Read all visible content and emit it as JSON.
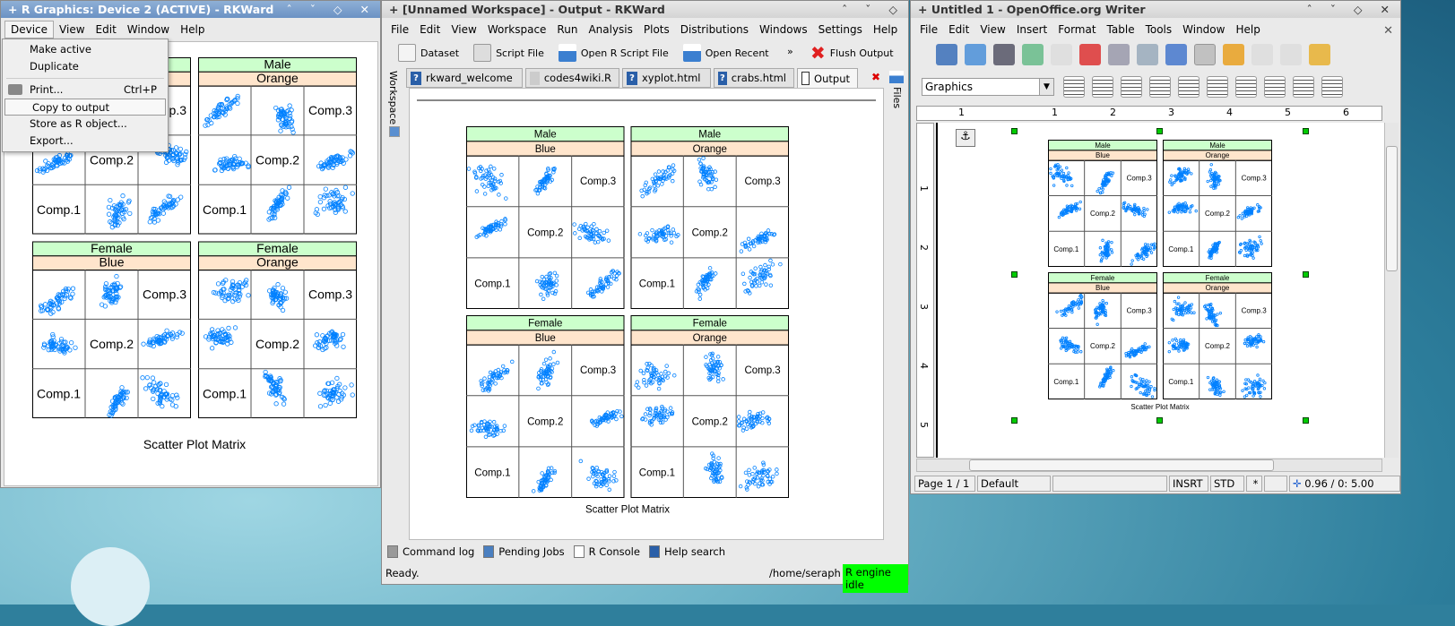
{
  "colors": {
    "strip_top": "#ccffcc",
    "strip_bottom": "#ffe5cc",
    "points": "#0080ff",
    "engine_idle": "#00ff00",
    "titlebar_active": "#7a9fcf",
    "desktop": "#2f7f9c"
  },
  "spm": {
    "title": "Scatter Plot Matrix",
    "vars": [
      "Comp.1",
      "Comp.2",
      "Comp.3"
    ],
    "panels": [
      {
        "top": "Female",
        "bottom": "Blue"
      },
      {
        "top": "Female",
        "bottom": "Orange"
      },
      {
        "top": "Male",
        "bottom": "Blue"
      },
      {
        "top": "Male",
        "bottom": "Orange"
      }
    ]
  },
  "graphics": {
    "title": "+ R Graphics: Device 2 (ACTIVE) - RKWard",
    "menu": [
      "Device",
      "View",
      "Edit",
      "Window",
      "Help"
    ],
    "device_menu": [
      {
        "label": "Make active",
        "icon": ""
      },
      {
        "label": "Duplicate",
        "icon": ""
      },
      {
        "label": "Print...",
        "shortcut": "Ctrl+P",
        "icon": "printer-icon"
      },
      {
        "label": "Copy to output",
        "icon": ""
      },
      {
        "label": "Store as R object...",
        "icon": ""
      },
      {
        "label": "Export...",
        "icon": ""
      }
    ]
  },
  "rkward": {
    "title": "+ [Unnamed Workspace] - Output - RKWard",
    "menu": [
      "File",
      "Edit",
      "View",
      "Workspace",
      "Run",
      "Analysis",
      "Plots",
      "Distributions",
      "Windows",
      "Settings",
      "Help"
    ],
    "toolbar": [
      "Dataset",
      "Script File",
      "Open R Script File",
      "Open Recent",
      "Flush Output"
    ],
    "tabs": [
      "rkward_welcome",
      "codes4wiki.R",
      "xyplot.html",
      "crabs.html",
      "Output"
    ],
    "side_left": "Workspace",
    "side_right": "Files",
    "bottom_tools": [
      "Command log",
      "Pending Jobs",
      "R Console",
      "Help search"
    ],
    "status": "Ready.",
    "path": "/home/seraph",
    "engine": "R engine idle"
  },
  "writer": {
    "title": "+ Untitled 1 - OpenOffice.org Writer",
    "menu": [
      "File",
      "Edit",
      "View",
      "Insert",
      "Format",
      "Table",
      "Tools",
      "Window",
      "Help"
    ],
    "style_value": "Graphics",
    "ruler": [
      "1",
      "1",
      "2",
      "3",
      "4",
      "5",
      "6"
    ],
    "vruler": [
      "1",
      "2",
      "3",
      "4",
      "5"
    ],
    "status": {
      "page": "Page 1 / 1",
      "style": "Default",
      "mode": "INSRT",
      "sel": "STD",
      "mod": "*",
      "pos": "0.96 / 0:",
      "size": "5.00"
    }
  }
}
